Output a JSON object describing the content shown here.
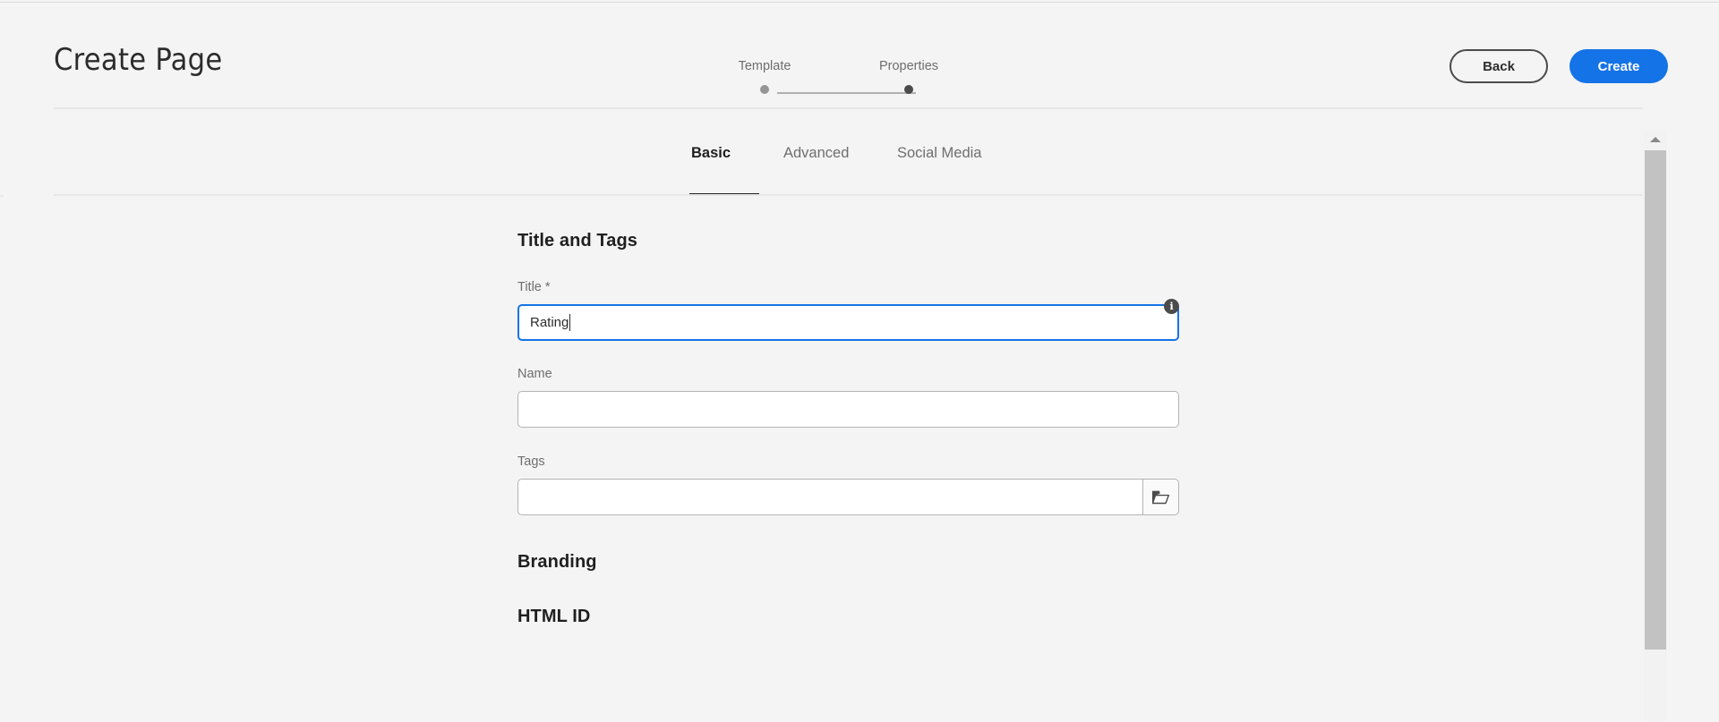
{
  "header": {
    "title": "Create Page",
    "back_label": "Back",
    "create_label": "Create"
  },
  "stepper": {
    "steps": [
      {
        "label": "Template",
        "state": "inactive"
      },
      {
        "label": "Properties",
        "state": "active"
      }
    ]
  },
  "tabs": [
    {
      "label": "Basic",
      "active": true
    },
    {
      "label": "Advanced",
      "active": false
    },
    {
      "label": "Social Media",
      "active": false
    }
  ],
  "form": {
    "sections": [
      {
        "heading": "Title and Tags"
      },
      {
        "heading": "Branding"
      },
      {
        "heading": "HTML ID"
      }
    ],
    "title_field": {
      "label": "Title *",
      "value": "Rating",
      "placeholder": ""
    },
    "name_field": {
      "label": "Name",
      "value": "",
      "placeholder": ""
    },
    "tags_field": {
      "label": "Tags",
      "value": "",
      "placeholder": "",
      "browse_icon": "folder-icon"
    },
    "info_icon": {
      "glyph": "i",
      "name": "info-icon"
    }
  },
  "colors": {
    "accent_blue": "#1473e6",
    "page_background": "#f4f4f4",
    "text_primary": "#2c2c2c",
    "text_secondary": "#6e6e6e",
    "active_dot": "#4b4b4b",
    "inactive_dot": "#959595"
  },
  "scrollbar": {
    "up_arrow_icon": "chevron-up-icon",
    "orientation": "vertical"
  }
}
